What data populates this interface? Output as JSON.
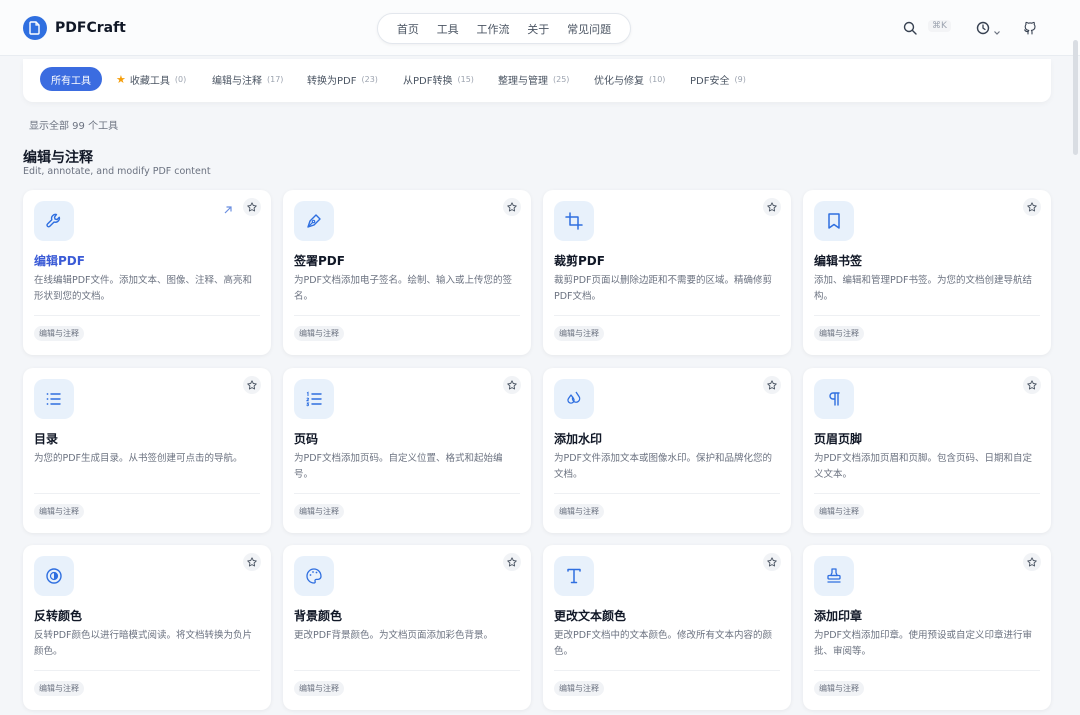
{
  "app": {
    "name": "PDFCraft"
  },
  "nav": [
    "首页",
    "工具",
    "工作流",
    "关于",
    "常见问题"
  ],
  "search_shortcut": "⌘K",
  "tabs": [
    {
      "label": "所有工具",
      "count": ""
    },
    {
      "label": "收藏工具",
      "count": "(0)"
    },
    {
      "label": "编辑与注释",
      "count": "(17)"
    },
    {
      "label": "转换为PDF",
      "count": "(23)"
    },
    {
      "label": "从PDF转换",
      "count": "(15)"
    },
    {
      "label": "整理与管理",
      "count": "(25)"
    },
    {
      "label": "优化与修复",
      "count": "(10)"
    },
    {
      "label": "PDF安全",
      "count": "(9)"
    }
  ],
  "summary": "显示全部 99 个工具",
  "section": {
    "title": "编辑与注释",
    "subtitle": "Edit, annotate, and modify PDF content"
  },
  "cards": [
    {
      "title": "编辑PDF",
      "desc": "在线编辑PDF文件。添加文本、图像、注释、高亮和形状到您的文档。",
      "tag": "编辑与注释",
      "icon": "wrench-icon"
    },
    {
      "title": "签署PDF",
      "desc": "为PDF文档添加电子签名。绘制、输入或上传您的签名。",
      "tag": "编辑与注释",
      "icon": "pen-nib-icon"
    },
    {
      "title": "裁剪PDF",
      "desc": "裁剪PDF页面以删除边距和不需要的区域。精确修剪PDF文档。",
      "tag": "编辑与注释",
      "icon": "crop-icon"
    },
    {
      "title": "编辑书签",
      "desc": "添加、编辑和管理PDF书签。为您的文档创建导航结构。",
      "tag": "编辑与注释",
      "icon": "bookmark-icon"
    },
    {
      "title": "目录",
      "desc": "为您的PDF生成目录。从书签创建可点击的导航。",
      "tag": "编辑与注释",
      "icon": "list-icon"
    },
    {
      "title": "页码",
      "desc": "为PDF文档添加页码。自定义位置、格式和起始编号。",
      "tag": "编辑与注释",
      "icon": "numbered-list-icon"
    },
    {
      "title": "添加水印",
      "desc": "为PDF文件添加文本或图像水印。保护和品牌化您的文档。",
      "tag": "编辑与注释",
      "icon": "droplets-icon"
    },
    {
      "title": "页眉页脚",
      "desc": "为PDF文档添加页眉和页脚。包含页码、日期和自定义文本。",
      "tag": "编辑与注释",
      "icon": "pilcrow-icon"
    },
    {
      "title": "反转颜色",
      "desc": "反转PDF颜色以进行暗模式阅读。将文档转换为负片颜色。",
      "tag": "编辑与注释",
      "icon": "contrast-icon"
    },
    {
      "title": "背景颜色",
      "desc": "更改PDF背景颜色。为文档页面添加彩色背景。",
      "tag": "编辑与注释",
      "icon": "palette-icon"
    },
    {
      "title": "更改文本颜色",
      "desc": "更改PDF文档中的文本颜色。修改所有文本内容的颜色。",
      "tag": "编辑与注释",
      "icon": "type-icon"
    },
    {
      "title": "添加印章",
      "desc": "为PDF文档添加印章。使用预设或自定义印章进行审批、审阅等。",
      "tag": "编辑与注释",
      "icon": "stamp-icon"
    }
  ],
  "colors": {
    "accent": "#3b6ce0",
    "link": "#3b5bd6",
    "icon_bg": "#e8f1fb",
    "page_bg": "#f4f6f9"
  }
}
